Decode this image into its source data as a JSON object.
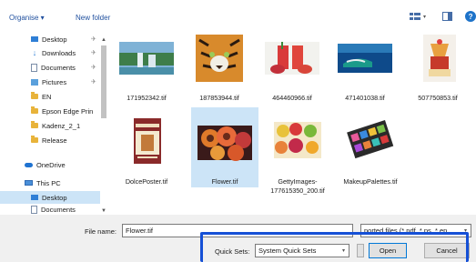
{
  "toolbar": {
    "organise_label": "Organise ▾",
    "new_folder_label": "New folder",
    "view_icon": "view-options-icon",
    "preview_pane_icon": "preview-pane-icon",
    "help_icon": "help-icon",
    "help_glyph": "?"
  },
  "sidebar": {
    "items": [
      {
        "label": "Desktop",
        "icon": "desktop-icon",
        "pinned": true
      },
      {
        "label": "Downloads",
        "icon": "download-icon",
        "pinned": true
      },
      {
        "label": "Documents",
        "icon": "document-icon",
        "pinned": true
      },
      {
        "label": "Pictures",
        "icon": "pictures-icon",
        "pinned": true
      },
      {
        "label": "EN",
        "icon": "folder-icon",
        "pinned": false
      },
      {
        "label": "Epson Edge Prin",
        "icon": "folder-icon",
        "pinned": false
      },
      {
        "label": "Kadenz_2_1",
        "icon": "folder-icon",
        "pinned": false
      },
      {
        "label": "Release",
        "icon": "folder-icon",
        "pinned": false
      },
      {
        "label": "OneDrive",
        "icon": "onedrive-icon",
        "pinned": false
      },
      {
        "label": "This PC",
        "icon": "this-pc-icon",
        "pinned": false
      },
      {
        "label": "Desktop",
        "icon": "desktop-icon",
        "pinned": false
      },
      {
        "label": "Documents",
        "icon": "document-icon",
        "pinned": false
      }
    ],
    "pin_glyph": "✈"
  },
  "files": [
    {
      "name": "171952342.tif",
      "selected": false
    },
    {
      "name": "187853944.tif",
      "selected": false
    },
    {
      "name": "464460966.tif",
      "selected": false
    },
    {
      "name": "471401038.tif",
      "selected": false
    },
    {
      "name": "507750853.tif",
      "selected": false
    },
    {
      "name": "DolcePoster.tif",
      "selected": false
    },
    {
      "name": "Flower.tif",
      "selected": true
    },
    {
      "name": "GettyImages-177615350_200.tif",
      "selected": false
    },
    {
      "name": "MakeupPalettes.tif",
      "selected": false
    }
  ],
  "bottom": {
    "file_name_label": "File name:",
    "file_name_value": "Flower.tif",
    "file_type_value": "ported files (*.pdf, *.ps, *.ep",
    "quick_sets_label": "Quick Sets:",
    "quick_sets_value": "System Quick Sets",
    "open_label": "Open",
    "cancel_label": "Cancel"
  },
  "colors": {
    "accent": "#0078d7",
    "highlight_box": "#1550d6",
    "selection": "#cce4f7"
  }
}
